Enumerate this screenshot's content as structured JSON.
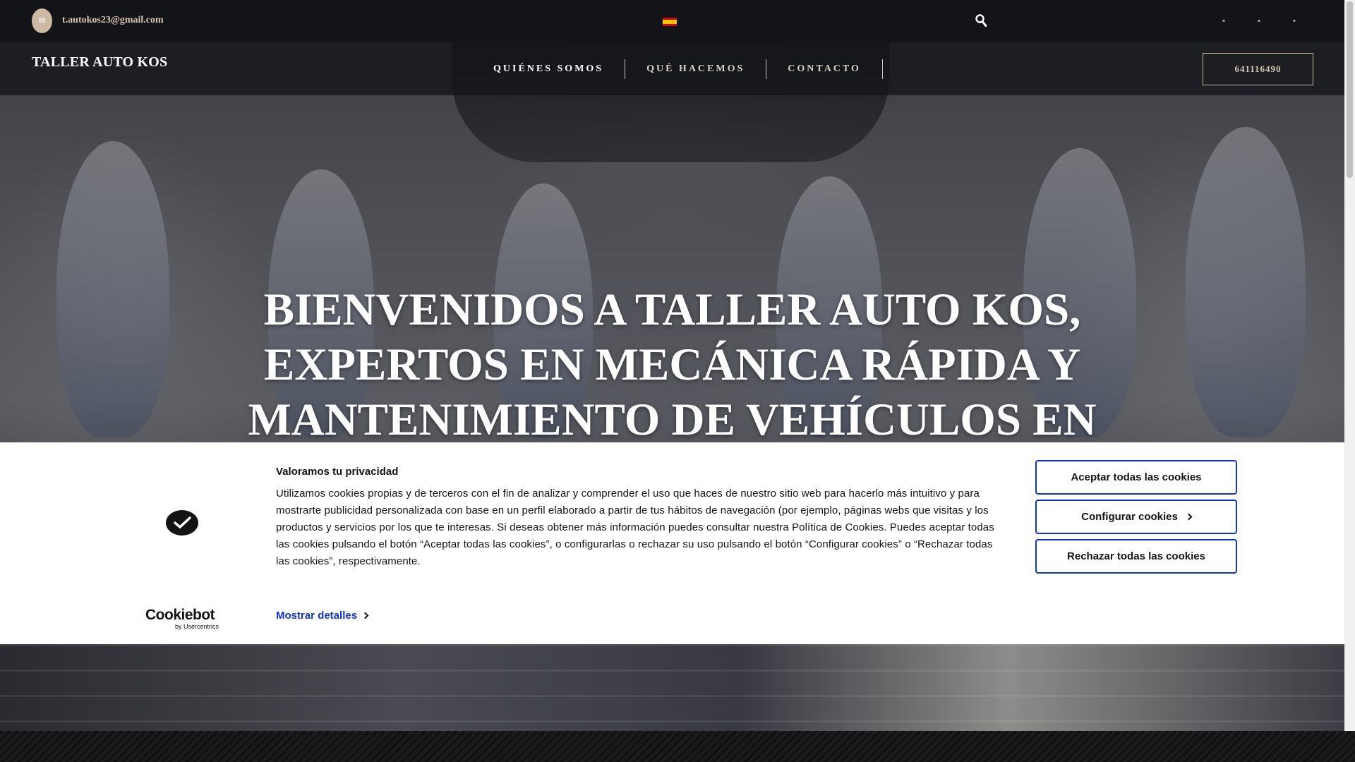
{
  "topbar": {
    "email": "t.autokos23@gmail.com",
    "language": "Español",
    "social_icons": [
      "facebook-icon",
      "instagram-icon",
      "whatsapp-icon"
    ]
  },
  "nav": {
    "logo": "TALLER AUTO KOS",
    "items": [
      {
        "label": "QUIÉNES SOMOS"
      },
      {
        "label": "QUÉ HACEMOS"
      },
      {
        "label": "CONTACTO"
      }
    ],
    "phone": "641116490"
  },
  "hero": {
    "headline": "BIENVENIDOS A TALLER AUTO KOS, EXPERTOS EN MECÁNICA RÁPIDA Y MANTENIMIENTO DE VEHÍCULOS EN"
  },
  "cookie_banner": {
    "brand": "Cookiebot",
    "brand_sub": "by Usercentrics",
    "title": "Valoramos tu privacidad",
    "body": "Utilizamos cookies propias y de terceros con el fin de analizar y comprender el uso que haces de nuestro sitio web para hacerlo más intuitivo y para mostrarte publicidad personalizada con base en un perfil elaborado a partir de tus hábitos de navegación (por ejemplo, páginas webs que visitas y los productos y servicios por los que te interesas. Si deseas obtener más información puedes consultar nuestra Política de Cookies. Puedes aceptar todas las cookies pulsando el botón “Aceptar todas las cookies”, o configurarlas o rechazar su uso pulsando el botón “Configurar cookies” o “Rechazar todas las cookies”, respectivamente.",
    "details_link": "Mostrar detalles",
    "accept_all": "Aceptar todas las cookies",
    "configure": "Configurar cookies",
    "reject_all": "Rechazar todas las cookies"
  },
  "colors": {
    "accent": "#cdb9a4",
    "cookie_button_border": "#1032cf",
    "topbar_bg": "#131418"
  }
}
